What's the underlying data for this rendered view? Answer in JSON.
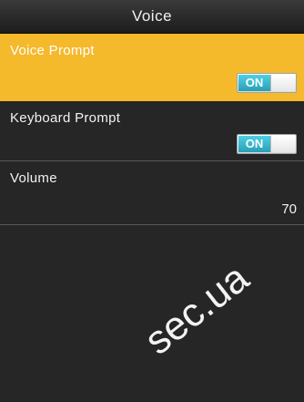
{
  "header": {
    "title": "Voice"
  },
  "settings": [
    {
      "label": "Voice Prompt",
      "control": "toggle",
      "value": "ON",
      "selected": true
    },
    {
      "label": "Keyboard Prompt",
      "control": "toggle",
      "value": "ON",
      "selected": false
    },
    {
      "label": "Volume",
      "control": "value",
      "value": "70",
      "selected": false
    }
  ],
  "watermark": {
    "text": "sec.ua"
  },
  "colors": {
    "selected_row": "#f5b92c",
    "background": "#262626",
    "toggle_on": "#2a9fb6"
  }
}
